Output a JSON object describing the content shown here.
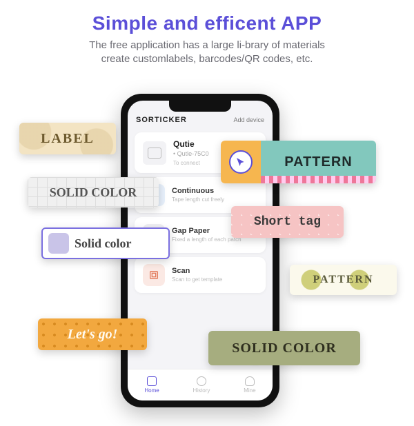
{
  "heading": "Simple and efficent APP",
  "subheading_line1": "The free application has a large li-brary of materials",
  "subheading_line2": "create customlabels, barcodes/QR codes, etc.",
  "phone": {
    "app_title": "SORTICKER",
    "add_device": "Add device",
    "device": {
      "name": "Qutie",
      "sub": "• Qutle-75C0",
      "status": "To connect"
    },
    "rows": [
      {
        "title": "Continuous",
        "sub": "Tape length cut freely"
      },
      {
        "title": "Gap Paper",
        "sub": "Fixed a length of each patch"
      },
      {
        "title": "Scan",
        "sub": "Scan to get template"
      }
    ],
    "nav": {
      "home": "Home",
      "history": "History",
      "mine": "Mine"
    },
    "help": "?"
  },
  "tags": {
    "label": "LABEL",
    "pattern_big": "PATTERN",
    "solid_gray": "SOLID COLOR",
    "short": "Short tag",
    "solid_white": "Solid color",
    "pattern_green": "PATTERN",
    "letsgo": "Let's go!",
    "solid_olive": "SOLID COLOR"
  }
}
